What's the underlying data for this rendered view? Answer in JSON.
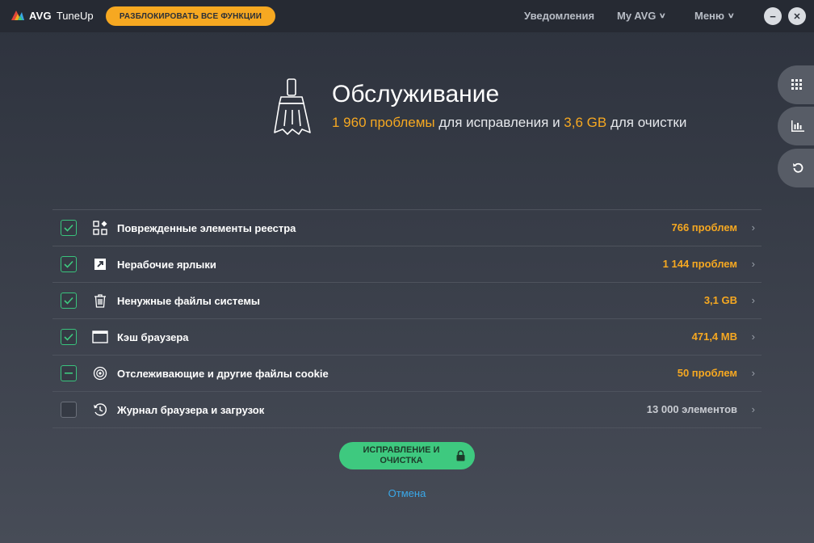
{
  "app": {
    "brand": "AVG",
    "product": "TuneUp",
    "unlock_label": "РАЗБЛОКИРОВАТЬ ВСЕ ФУНКЦИИ"
  },
  "topnav": {
    "notifications": "Уведомления",
    "my_avg": "My AVG",
    "menu": "Меню"
  },
  "window": {
    "minimize": "−",
    "close": "✕"
  },
  "side_panel": {
    "items": [
      "apps-grid-icon",
      "chart-icon",
      "undo-icon"
    ]
  },
  "header": {
    "title": "Обслуживание",
    "problems_count": "1 960 проблемы",
    "text_mid": " для исправления и ",
    "size": "3,6 GB",
    "text_end": " для очистки"
  },
  "items": [
    {
      "label": "Поврежденные элементы реестра",
      "value": "766 проблем",
      "state": "checked",
      "icon": "registry-icon",
      "value_color": "orange"
    },
    {
      "label": "Нерабочие ярлыки",
      "value": "1 144 проблем",
      "state": "checked",
      "icon": "shortcut-icon",
      "value_color": "orange"
    },
    {
      "label": "Ненужные файлы системы",
      "value": "3,1 GB",
      "state": "checked",
      "icon": "trash-icon",
      "value_color": "orange"
    },
    {
      "label": "Кэш браузера",
      "value": "471,4 MB",
      "state": "checked",
      "icon": "browser-window-icon",
      "value_color": "orange"
    },
    {
      "label": "Отслеживающие и другие файлы cookie",
      "value": "50 проблем",
      "state": "partial",
      "icon": "target-icon",
      "value_color": "orange"
    },
    {
      "label": "Журнал браузера и загрузок",
      "value": "13 000 элементов",
      "state": "unchecked",
      "icon": "history-icon",
      "value_color": "grey"
    }
  ],
  "actions": {
    "fix_label_line1": "ИСПРАВЛЕНИЕ И",
    "fix_label_line2": "ОЧИСТКА",
    "cancel_label": "Отмена"
  },
  "colors": {
    "accent_orange": "#f6a821",
    "accent_green": "#3ec97f",
    "link_blue": "#3aa8e8",
    "background": "#2d323d"
  }
}
